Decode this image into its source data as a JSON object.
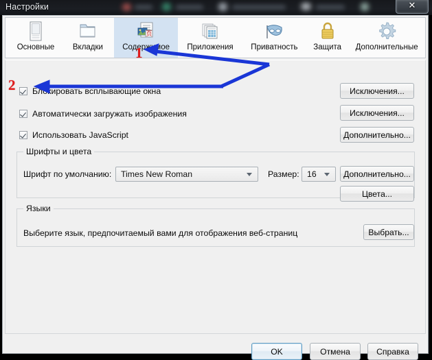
{
  "window": {
    "title": "Настройки",
    "close_label": "✕"
  },
  "tabs": [
    {
      "label": "Основные",
      "icon": "general-page-icon",
      "selected": false
    },
    {
      "label": "Вкладки",
      "icon": "folder-tabs-icon",
      "selected": false
    },
    {
      "label": "Содержимое",
      "icon": "content-page-icon",
      "selected": true
    },
    {
      "label": "Приложения",
      "icon": "applications-icon",
      "selected": false
    },
    {
      "label": "Приватность",
      "icon": "mask-icon",
      "selected": false
    },
    {
      "label": "Защита",
      "icon": "padlock-icon",
      "selected": false
    },
    {
      "label": "Дополнительные",
      "icon": "gear-icon",
      "selected": false
    }
  ],
  "content": {
    "checkboxes": [
      {
        "label": "Блокировать всплывающие окна",
        "checked": true
      },
      {
        "label": "Автоматически загружать изображения",
        "checked": true
      },
      {
        "label": "Использовать JavaScript",
        "checked": true
      }
    ],
    "side_buttons": [
      {
        "label": "Исключения..."
      },
      {
        "label": "Исключения..."
      },
      {
        "label": "Дополнительно..."
      }
    ],
    "fonts_group": {
      "title": "Шрифты и цвета",
      "font_label": "Шрифт по умолчанию:",
      "font_value": "Times New Roman",
      "size_label": "Размер:",
      "size_value": "16",
      "advanced_button": "Дополнительно...",
      "colors_button": "Цвета..."
    },
    "languages_group": {
      "title": "Языки",
      "description": "Выберите язык, предпочитаемый вами для отображения веб-страниц",
      "choose_button": "Выбрать..."
    }
  },
  "footer": {
    "ok_label": "OK",
    "cancel_label": "Отмена",
    "help_label": "Справка"
  },
  "annotations": {
    "marker_one": "1",
    "marker_two": "2",
    "arrow_color": "#1a36d6",
    "marker_color": "#e01b1b"
  }
}
